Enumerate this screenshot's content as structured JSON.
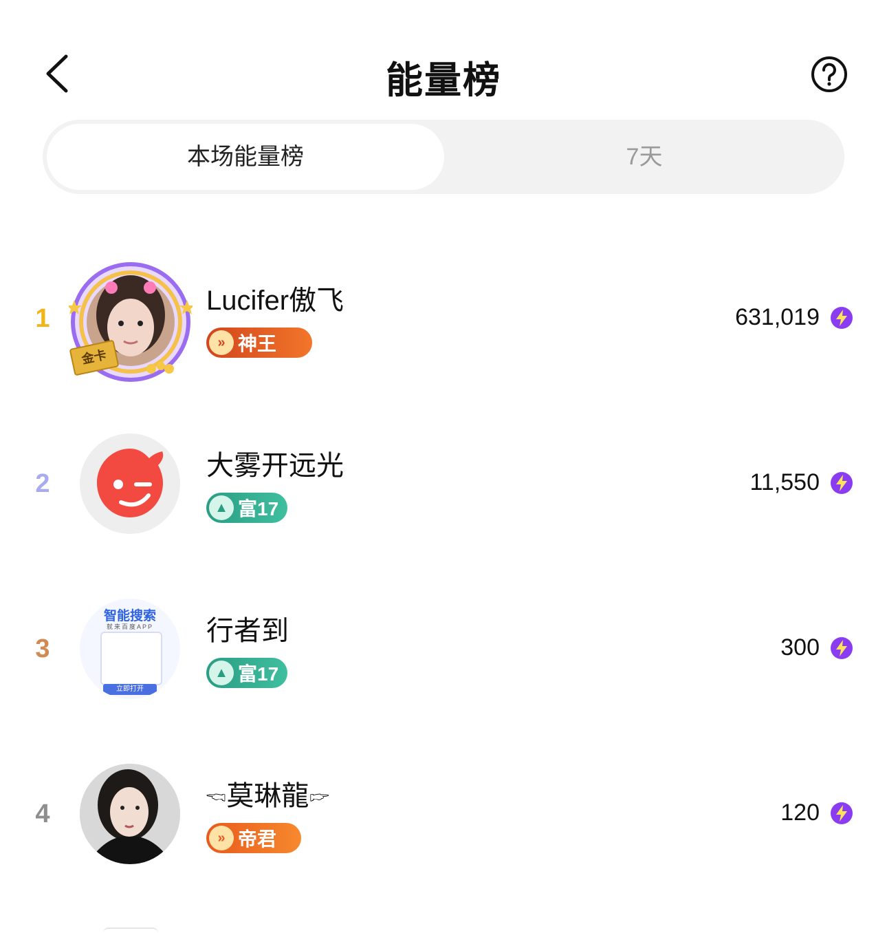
{
  "header": {
    "title": "能量榜",
    "back_icon": "chevron-left-icon",
    "help_icon": "question-circle-icon"
  },
  "tabs": [
    {
      "label": "本场能量榜",
      "active": true
    },
    {
      "label": "7天",
      "active": false
    }
  ],
  "colors": {
    "rank1": "#f2b416",
    "rank2": "#a9abf0",
    "rank3": "#d08a52",
    "rank4": "#8e8e8e",
    "energy": "#8a3df0"
  },
  "leaderboard": [
    {
      "rank": "1",
      "name": "Lucifer傲飞",
      "badge": "神王",
      "score": "631,019"
    },
    {
      "rank": "2",
      "name": "大雾开远光",
      "badge": "富17",
      "score": "11,550"
    },
    {
      "rank": "3",
      "name": "行者到",
      "badge": "富17",
      "score": "300",
      "avatar_texts": [
        "智能搜索",
        "就来百度APP",
        "立即打开"
      ]
    },
    {
      "rank": "4",
      "name": "🖘莫琳龍🖙",
      "badge": "帝君",
      "score": "120"
    }
  ],
  "avatar_misc": {
    "card_label": "金卡"
  }
}
